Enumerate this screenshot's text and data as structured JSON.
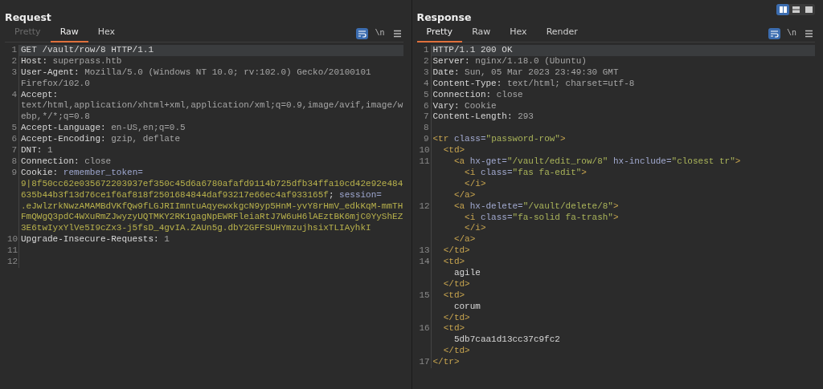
{
  "layout_toggle": [
    {
      "selected": true
    },
    {
      "selected": false
    },
    {
      "selected": false
    }
  ],
  "panes": [
    {
      "title": "Request",
      "tabs": [
        {
          "label": "Pretty",
          "selected": false,
          "disabled": true
        },
        {
          "label": "Raw",
          "selected": true,
          "disabled": false
        },
        {
          "label": "Hex",
          "selected": false,
          "disabled": false
        }
      ],
      "wrap_on": true,
      "newline_label": "\\n",
      "lines": [
        {
          "number": "1",
          "selected": true,
          "rows": [
            {
              "tokens": [
                {
                  "kind": "name",
                  "text": "GET /vault/row/8 HTTP/1.1"
                }
              ]
            }
          ]
        },
        {
          "number": "2",
          "selected": false,
          "rows": [
            {
              "tokens": [
                {
                  "kind": "name",
                  "text": "Host: "
                },
                {
                  "kind": "value",
                  "text": "superpass.htb"
                }
              ]
            }
          ]
        },
        {
          "number": "3",
          "selected": false,
          "rows": [
            {
              "tokens": [
                {
                  "kind": "name",
                  "text": "User-Agent: "
                },
                {
                  "kind": "value",
                  "text": "Mozilla/5.0 (Windows NT 10.0; rv:102.0) Gecko/20100101"
                }
              ]
            },
            {
              "tokens": [
                {
                  "kind": "value",
                  "text": "Firefox/102.0"
                }
              ]
            }
          ]
        },
        {
          "number": "4",
          "selected": false,
          "rows": [
            {
              "tokens": [
                {
                  "kind": "name",
                  "text": "Accept:"
                }
              ]
            },
            {
              "tokens": [
                {
                  "kind": "value",
                  "text": "text/html,application/xhtml+xml,application/xml;q=0.9,image/avif,image/w"
                }
              ]
            },
            {
              "tokens": [
                {
                  "kind": "value",
                  "text": "ebp,*/*;q=0.8"
                }
              ]
            }
          ]
        },
        {
          "number": "5",
          "selected": false,
          "rows": [
            {
              "tokens": [
                {
                  "kind": "name",
                  "text": "Accept-Language: "
                },
                {
                  "kind": "value",
                  "text": "en-US,en;q=0.5"
                }
              ]
            }
          ]
        },
        {
          "number": "6",
          "selected": false,
          "rows": [
            {
              "tokens": [
                {
                  "kind": "name",
                  "text": "Accept-Encoding: "
                },
                {
                  "kind": "value",
                  "text": "gzip, deflate"
                }
              ]
            }
          ]
        },
        {
          "number": "7",
          "selected": false,
          "rows": [
            {
              "tokens": [
                {
                  "kind": "name",
                  "text": "DNT: "
                },
                {
                  "kind": "value",
                  "text": "1"
                }
              ]
            }
          ]
        },
        {
          "number": "8",
          "selected": false,
          "rows": [
            {
              "tokens": [
                {
                  "kind": "name",
                  "text": "Connection: "
                },
                {
                  "kind": "value",
                  "text": "close"
                }
              ]
            }
          ]
        },
        {
          "number": "9",
          "selected": false,
          "rows": [
            {
              "tokens": [
                {
                  "kind": "name",
                  "text": "Cookie: "
                },
                {
                  "kind": "cookie_name",
                  "text": "remember_token="
                }
              ]
            },
            {
              "tokens": [
                {
                  "kind": "cookie_value",
                  "text": "9|8f50cc62e035672203937ef350c45d6a6780afafd9114b725dfb34ffa10cd42e92e484"
                }
              ]
            },
            {
              "tokens": [
                {
                  "kind": "cookie_value",
                  "text": "635b44b3f13d76ce1f6af818f2501684844daf93217e66ec4af933165f"
                },
                {
                  "kind": "name",
                  "text": "; "
                },
                {
                  "kind": "cookie_name",
                  "text": "session="
                }
              ]
            },
            {
              "tokens": [
                {
                  "kind": "cookie_value",
                  "text": ".eJwlzrkNwzAMAMBdVKfQw9fLGJRIImntuAqyewxkgcN9yp5HnM-yvY8rHmV_edkKqM-mmTH"
                }
              ]
            },
            {
              "tokens": [
                {
                  "kind": "cookie_value",
                  "text": "FmQWgQ3pdC4WXuRmZJwyzyUQTMKY2RK1gagNpEWRFleiaRtJ7W6uH6lAEztBK6mjC0YyShEZ"
                }
              ]
            },
            {
              "tokens": [
                {
                  "kind": "cookie_value",
                  "text": "3E6twIyxYlVe5I9cZx3-j5fsD_4gvIA.ZAUn5g.dbY2GFFSUHYmzujhsixTLIAyhkI"
                }
              ]
            }
          ]
        },
        {
          "number": "10",
          "selected": false,
          "rows": [
            {
              "tokens": [
                {
                  "kind": "name",
                  "text": "Upgrade-Insecure-Requests: "
                },
                {
                  "kind": "value",
                  "text": "1"
                }
              ]
            }
          ]
        },
        {
          "number": "11",
          "selected": false,
          "rows": [
            {}
          ]
        },
        {
          "number": "12",
          "selected": false,
          "rows": [
            {}
          ]
        }
      ]
    },
    {
      "title": "Response",
      "tabs": [
        {
          "label": "Pretty",
          "selected": true,
          "disabled": false
        },
        {
          "label": "Raw",
          "selected": false,
          "disabled": false
        },
        {
          "label": "Hex",
          "selected": false,
          "disabled": false
        },
        {
          "label": "Render",
          "selected": false,
          "disabled": false
        }
      ],
      "wrap_on": true,
      "newline_label": "\\n",
      "lines": [
        {
          "number": "1",
          "selected": true,
          "rows": [
            {
              "tokens": [
                {
                  "kind": "name",
                  "text": "HTTP/1.1 200 OK"
                }
              ]
            }
          ]
        },
        {
          "number": "2",
          "selected": false,
          "rows": [
            {
              "tokens": [
                {
                  "kind": "name",
                  "text": "Server: "
                },
                {
                  "kind": "value",
                  "text": "nginx/1.18.0 (Ubuntu)"
                }
              ]
            }
          ]
        },
        {
          "number": "3",
          "selected": false,
          "rows": [
            {
              "tokens": [
                {
                  "kind": "name",
                  "text": "Date: "
                },
                {
                  "kind": "value",
                  "text": "Sun, 05 Mar 2023 23:49:30 GMT"
                }
              ]
            }
          ]
        },
        {
          "number": "4",
          "selected": false,
          "rows": [
            {
              "tokens": [
                {
                  "kind": "name",
                  "text": "Content-Type: "
                },
                {
                  "kind": "value",
                  "text": "text/html; charset=utf-8"
                }
              ]
            }
          ]
        },
        {
          "number": "5",
          "selected": false,
          "rows": [
            {
              "tokens": [
                {
                  "kind": "name",
                  "text": "Connection: "
                },
                {
                  "kind": "value",
                  "text": "close"
                }
              ]
            }
          ]
        },
        {
          "number": "6",
          "selected": false,
          "rows": [
            {
              "tokens": [
                {
                  "kind": "name",
                  "text": "Vary: "
                },
                {
                  "kind": "value",
                  "text": "Cookie"
                }
              ]
            }
          ]
        },
        {
          "number": "7",
          "selected": false,
          "rows": [
            {
              "tokens": [
                {
                  "kind": "name",
                  "text": "Content-Length: "
                },
                {
                  "kind": "value",
                  "text": "293"
                }
              ]
            }
          ]
        },
        {
          "number": "8",
          "selected": false,
          "rows": [
            {}
          ]
        },
        {
          "number": "9",
          "selected": false,
          "rows": [
            {
              "tokens": [
                {
                  "kind": "tag",
                  "text": "<tr"
                },
                {
                  "kind": "attr",
                  "text": " class="
                },
                {
                  "kind": "string",
                  "text": "\"password-row\""
                },
                {
                  "kind": "tag",
                  "text": ">"
                }
              ]
            }
          ]
        },
        {
          "number": "10",
          "selected": false,
          "rows": [
            {
              "tokens": [
                {
                  "kind": "tag",
                  "text": "  <td>"
                }
              ]
            }
          ]
        },
        {
          "number": "11",
          "selected": false,
          "rows": [
            {
              "tokens": [
                {
                  "kind": "tag",
                  "text": "    <a"
                },
                {
                  "kind": "attr",
                  "text": " hx-get="
                },
                {
                  "kind": "string",
                  "text": "\"/vault/edit_row/8\""
                },
                {
                  "kind": "attr",
                  "text": " hx-include="
                },
                {
                  "kind": "string",
                  "text": "\"closest tr\""
                },
                {
                  "kind": "tag",
                  "text": ">"
                }
              ]
            },
            {
              "tokens": [
                {
                  "kind": "tag",
                  "text": "      <i"
                },
                {
                  "kind": "attr",
                  "text": " class="
                },
                {
                  "kind": "string",
                  "text": "\"fas fa-edit\""
                },
                {
                  "kind": "tag",
                  "text": ">"
                }
              ]
            },
            {
              "tokens": [
                {
                  "kind": "tag",
                  "text": "      </i>"
                }
              ]
            },
            {
              "tokens": [
                {
                  "kind": "tag",
                  "text": "    </a>"
                }
              ]
            }
          ]
        },
        {
          "number": "12",
          "selected": false,
          "rows": [
            {
              "tokens": [
                {
                  "kind": "tag",
                  "text": "    <a"
                },
                {
                  "kind": "attr",
                  "text": " hx-delete="
                },
                {
                  "kind": "string",
                  "text": "\"/vault/delete/8\""
                },
                {
                  "kind": "tag",
                  "text": ">"
                }
              ]
            },
            {
              "tokens": [
                {
                  "kind": "tag",
                  "text": "      <i"
                },
                {
                  "kind": "attr",
                  "text": " class="
                },
                {
                  "kind": "string",
                  "text": "\"fa-solid fa-trash\""
                },
                {
                  "kind": "tag",
                  "text": ">"
                }
              ]
            },
            {
              "tokens": [
                {
                  "kind": "tag",
                  "text": "      </i>"
                }
              ]
            },
            {
              "tokens": [
                {
                  "kind": "tag",
                  "text": "    </a>"
                }
              ]
            }
          ]
        },
        {
          "number": "13",
          "selected": false,
          "rows": [
            {
              "tokens": [
                {
                  "kind": "tag",
                  "text": "  </td>"
                }
              ]
            }
          ]
        },
        {
          "number": "14",
          "selected": false,
          "rows": [
            {
              "tokens": [
                {
                  "kind": "tag",
                  "text": "  <td>"
                }
              ]
            },
            {
              "tokens": [
                {
                  "kind": "text",
                  "text": "    agile"
                }
              ]
            },
            {
              "tokens": [
                {
                  "kind": "tag",
                  "text": "  </td>"
                }
              ]
            }
          ]
        },
        {
          "number": "15",
          "selected": false,
          "rows": [
            {
              "tokens": [
                {
                  "kind": "tag",
                  "text": "  <td>"
                }
              ]
            },
            {
              "tokens": [
                {
                  "kind": "text",
                  "text": "    corum"
                }
              ]
            },
            {
              "tokens": [
                {
                  "kind": "tag",
                  "text": "  </td>"
                }
              ]
            }
          ]
        },
        {
          "number": "16",
          "selected": false,
          "rows": [
            {
              "tokens": [
                {
                  "kind": "tag",
                  "text": "  <td>"
                }
              ]
            },
            {
              "tokens": [
                {
                  "kind": "text",
                  "text": "    5db7caa1d13cc37c9fc2"
                }
              ]
            },
            {
              "tokens": [
                {
                  "kind": "tag",
                  "text": "  </td>"
                }
              ]
            }
          ]
        },
        {
          "number": "17",
          "selected": false,
          "rows": [
            {
              "tokens": [
                {
                  "kind": "tag",
                  "text": "</tr>"
                }
              ]
            }
          ]
        }
      ]
    }
  ]
}
